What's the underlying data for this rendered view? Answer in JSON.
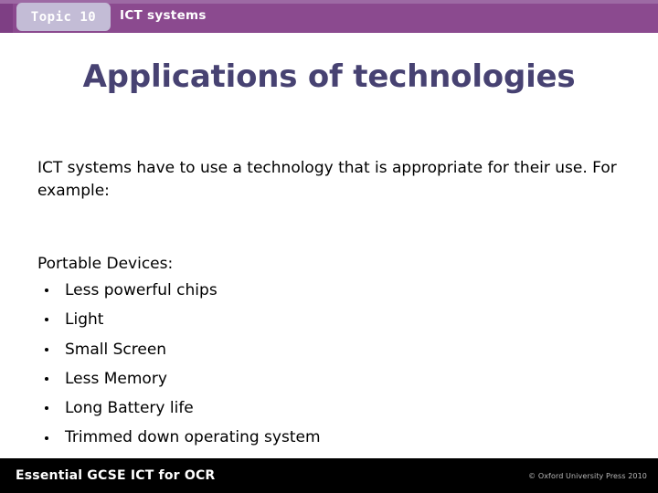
{
  "header": {
    "topic_badge": "Topic 10",
    "section_title": "ICT systems",
    "bar_color": "#8b4a8f",
    "badge_color": "#c3bcd6"
  },
  "slide": {
    "title": "Applications of technologies",
    "title_color": "#474272",
    "intro": "ICT systems have to use a technology that is appropriate for their use.  For example:",
    "section_heading": "Portable Devices:",
    "bullets": [
      "Less powerful chips",
      "Light",
      "Small Screen",
      "Less Memory",
      "Long Battery life",
      "Trimmed down operating system"
    ]
  },
  "footer": {
    "brand": "Essential GCSE ICT for OCR",
    "copyright": "© Oxford University Press 2010",
    "bar_color": "#000000"
  }
}
